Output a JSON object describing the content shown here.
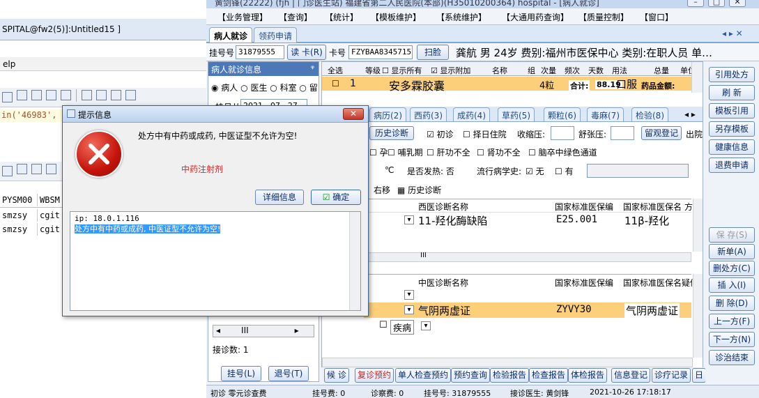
{
  "back_window": {
    "title": "SPITAL@fw2(5)]:Untitled15 ]",
    "menu_help": "elp",
    "code_line": "in('46983',",
    "grid_headers": [
      "PYSM00",
      "WBSM"
    ],
    "grid_rows": [
      [
        "smzsy",
        "cgit"
      ],
      [
        "smzsy",
        "cgit"
      ]
    ]
  },
  "main_window": {
    "title": "黄剑锋(22222) (fjh | 门诊医生站) 福建省第二人民医院(本部)(H35010200364) hospital - [病人就诊]",
    "menu": [
      "【业务管理】",
      "【查询】",
      "【统计】",
      "【模板维护】",
      "【系统维护】",
      "【大通用药查询】",
      "【质量控制】",
      "【窗口】"
    ],
    "tabs": [
      "病人就诊",
      "领药申请"
    ],
    "tab_nav": "◂ ▸ ✕",
    "reg_label": "挂号号",
    "reg_no": "31879555",
    "read_card_btn": "读 卡(R)",
    "card_label": "卡号",
    "card_no": "FZYBAA8345715",
    "scan_btn": "扫脸",
    "patient_info": "龚航  男  24岁  费别:福州市医保中心  类别:在职人员  单…"
  },
  "left_panel": {
    "header": "病人就诊信息",
    "pin": "ᵠ",
    "radios": [
      "病人",
      "医生",
      "科室",
      "留"
    ],
    "date_label": "挂号从",
    "date_value": "2021 - 07 - 27",
    "count_label": "接诊数: 1",
    "btn_register": "挂号(L)",
    "btn_return": "退号(T)"
  },
  "rx_grid": {
    "headers": [
      "全选",
      "等级",
      "显示所有",
      "显示附加",
      "名称",
      "组",
      "次量",
      "频次",
      "天数",
      "用法",
      "总量",
      "单位"
    ],
    "row_index": "1",
    "drug_name": "安多霖胶囊",
    "qty": "4粒",
    "usage": "口服",
    "total_label": "合计:",
    "total_value": "88.19",
    "drug_amount_label": "药品金额:"
  },
  "sub_tabs": [
    "病历(2)",
    "西药(3)",
    "成药(4)",
    "草药(5)",
    "颗粒(6)",
    "毒麻(7)",
    "检验(8)"
  ],
  "visit_row": {
    "history_btn": "历史诊断",
    "first_visit": "初诊",
    "hospital_select": "择日住院",
    "sbp_label": "收缩压:",
    "dbp_label": "舒张压:",
    "observe_btn": "留观登记",
    "discharge": "出院"
  },
  "conditions": [
    "孕妇",
    "哺乳期",
    "肝功不全",
    "肾功不全",
    "脑卒中绿色通道"
  ],
  "temp_row": {
    "unit": "℃",
    "fever": "是否发热: 否",
    "epi_label": "流行病学史:",
    "epi_none": "无",
    "epi_yes": "有"
  },
  "diag_toolbar": {
    "right_move": "右移",
    "history": "历史诊断"
  },
  "west_diag": {
    "headers": [
      "西医诊断名称",
      "国家标准医保编",
      "国家标准医保名",
      "方位"
    ],
    "name": "11-羟化酶缺陷",
    "code": "E25.001",
    "std_name": "11β-羟化"
  },
  "tcm_diag": {
    "headers": [
      "中医诊断名称",
      "国家标准医保编",
      "国家标准医保名",
      "疑似"
    ],
    "name": "气阴两虚证",
    "code": "ZYVY30",
    "std_name": "气阴两虚证",
    "row3_type": "疾病"
  },
  "right_buttons": [
    "引用处方",
    "刷 新",
    "模板引用",
    "另存模板",
    "健康信息",
    "退费申请",
    "保 存(S)",
    "新单(A)",
    "删处方(C)",
    "插 入(I)",
    "删 除(D)",
    "上一方(F)",
    "下一方(N)",
    "诊治结束"
  ],
  "bottom_buttons": [
    "候 诊",
    "复诊预约",
    "单人检查预约",
    "预约查询",
    "检验报告",
    "检查报告",
    "体检报告",
    "信息登记",
    "诊疗记录",
    "日"
  ],
  "status": {
    "first_visit": "初诊  零元诊查费",
    "reg_fee": "挂号费:  0",
    "diag_fee": "诊察费:  0",
    "reg_no": "挂号号:  31879555",
    "doctor": "接诊医生:  黄剑锋",
    "datetime": "2021-10-26 17:18:17"
  },
  "dialog": {
    "title": "提示信息",
    "message": "处方中有中药或成药, 中医证型不允许为空!",
    "annotation": "中药注射剂",
    "detail_btn": "详细信息",
    "ok_btn": "确定",
    "detail_ip": "ip: 18.0.1.116",
    "detail_msg": "处方中有中药或成药, 中医证型不允许为空!"
  },
  "colors": {
    "accent": "#4d78b8",
    "highlight_row": "#fcd07a",
    "error_red": "#c4140a",
    "annotation_red": "#e02020"
  }
}
